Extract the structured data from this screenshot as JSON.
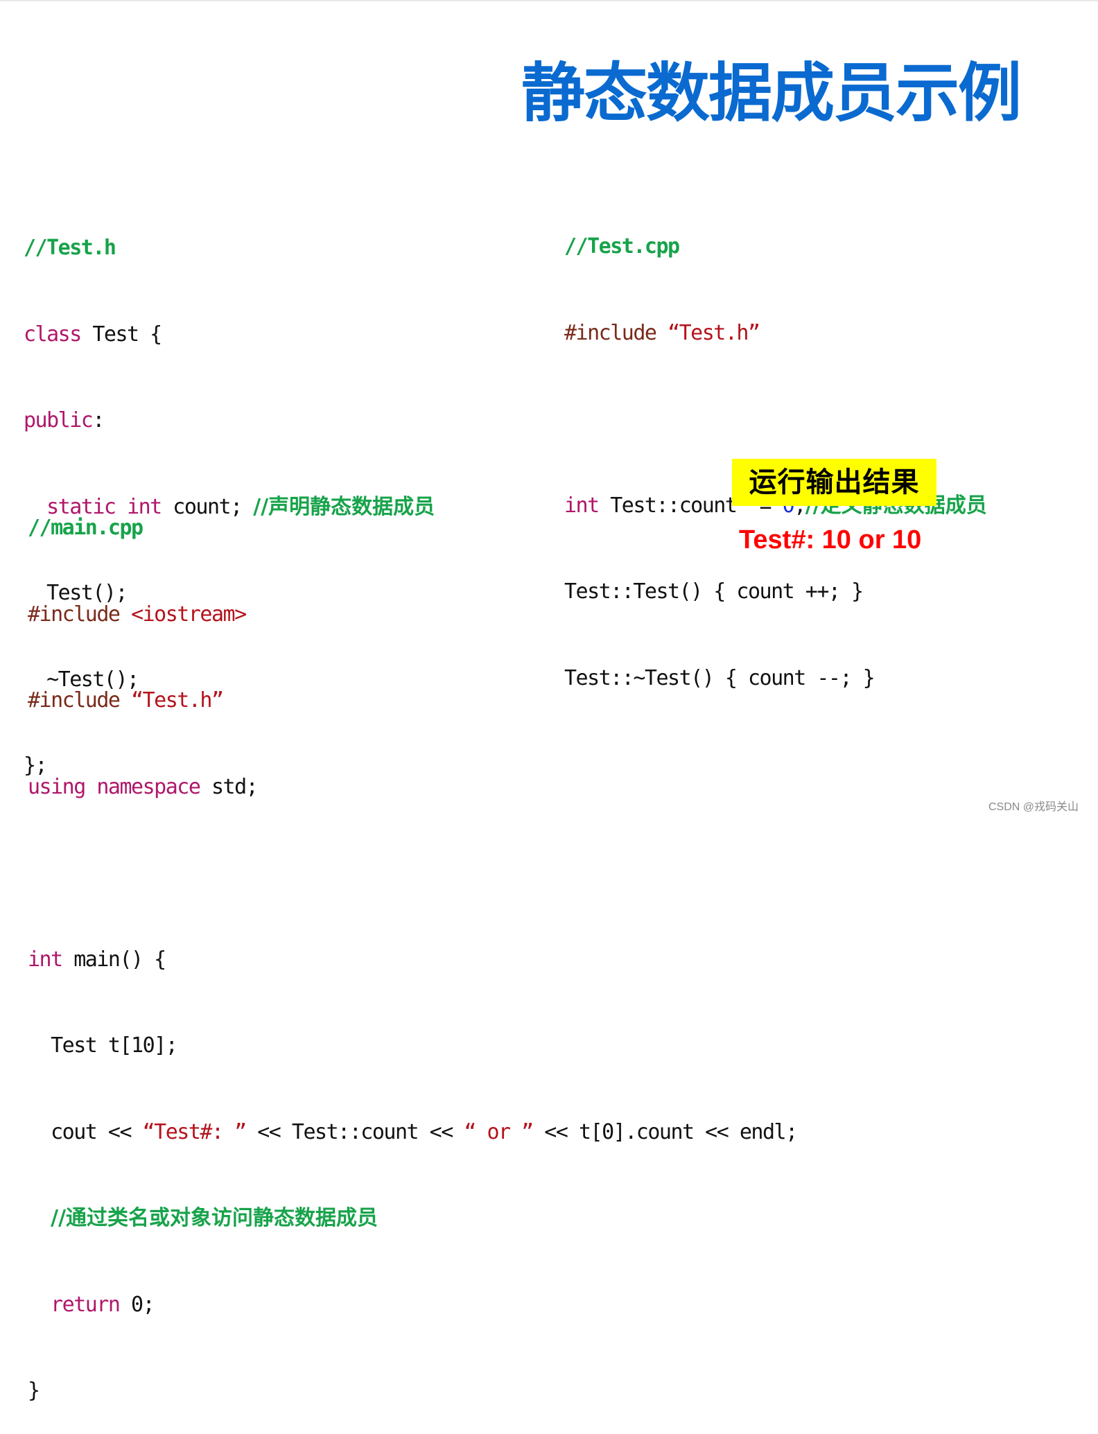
{
  "slide": {
    "title": "静态数据成员示例"
  },
  "test_h": {
    "filename_comment": "//Test.h",
    "line_class": {
      "kw": "class",
      "rest": " Test {"
    },
    "line_public": {
      "kw": "public",
      "rest": ":"
    },
    "line_static": {
      "indent": "  ",
      "kw1": "static",
      "sp1": " ",
      "kw2": "int",
      "rest": " count; ",
      "comment": "//声明静态数据成员"
    },
    "line_ctor": "  Test();",
    "line_dtor": "  ~Test();",
    "line_close": "};"
  },
  "test_cpp": {
    "filename_comment": "//Test.cpp",
    "line_include": {
      "directive": "#include ",
      "file": "“Test.h”"
    },
    "line_def": {
      "kw": "int",
      "mid": " Test::count  = ",
      "num": "0",
      "semi": ";",
      "comment": "//定义静态数据成员"
    },
    "line_ctor": "Test::Test() { count ++; }",
    "line_dtor": "Test::~Test() { count --; }"
  },
  "main_cpp": {
    "filename_comment": "//main.cpp",
    "line_include1": {
      "directive": "#include ",
      "file": "<iostream>"
    },
    "line_include2": {
      "directive": "#include ",
      "file": "“Test.h”"
    },
    "line_using": {
      "kw": "using namespace",
      "rest": " std;"
    },
    "line_main": {
      "kw": "int",
      "rest": " main() {"
    },
    "line_array": "  Test t[10];",
    "line_cout": {
      "p1": "  cout << ",
      "s1": "“Test#: ”",
      "p2": " << Test::count << ",
      "s2": "“ or ”",
      "p3": " << t[0].count << endl;"
    },
    "line_comment": "//通过类名或对象访问静态数据成员",
    "line_return": {
      "indent": "  ",
      "kw": "return",
      "rest": " 0;"
    },
    "line_close": "}"
  },
  "result": {
    "label": "运行输出结果",
    "output": "Test#: 10 or 10"
  },
  "watermark": "CSDN @戎码关山",
  "colors": {
    "title": "#0a6ad0",
    "comment": "#17a34a",
    "keyword": "#b0166a",
    "preprocessor": "#7a2a1a",
    "string": "#b5121b",
    "number": "#1530d6",
    "result_bg": "#ffff00",
    "result_text": "#ff0000"
  }
}
